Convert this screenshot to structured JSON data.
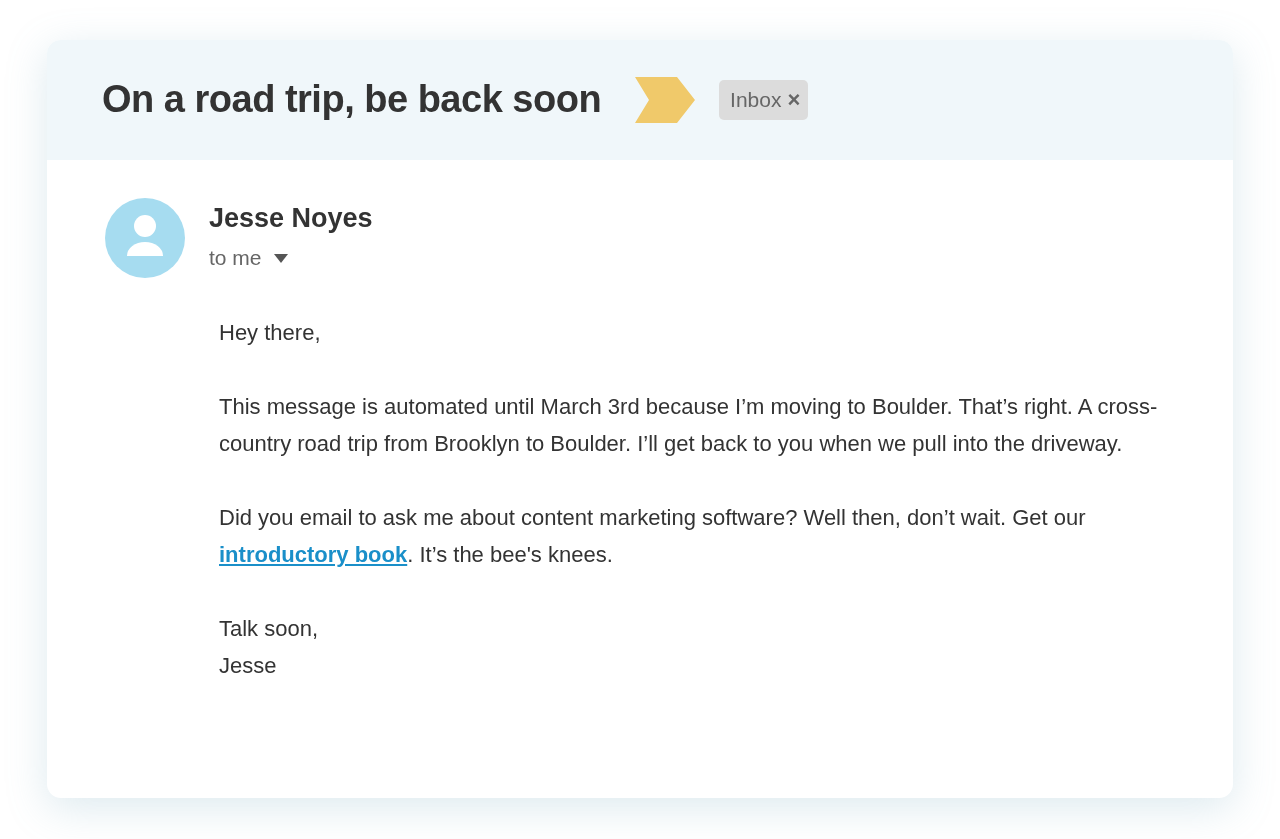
{
  "email": {
    "subject": "On a road trip, be back soon",
    "label": {
      "text": "Inbox",
      "close": "×"
    },
    "sender": {
      "name": "Jesse Noyes",
      "recipient": "to me"
    },
    "body": [
      {
        "segments": [
          {
            "kind": "text",
            "text": "Hey there,"
          }
        ]
      },
      {
        "segments": [
          {
            "kind": "text",
            "text": "This message is automated until March 3rd because I’m moving to Boulder. That’s right. A cross-country road trip from Brooklyn to Boulder. I’ll get back to you when we pull into the driveway."
          }
        ]
      },
      {
        "segments": [
          {
            "kind": "text",
            "text": "Did you email to ask me about content marketing software? Well then, don’t wait. Get our "
          },
          {
            "kind": "link",
            "text": "introductory book"
          },
          {
            "kind": "text",
            "text": ". It’s the bee's knees."
          }
        ]
      },
      {
        "segments": [
          {
            "kind": "text",
            "text": "Talk soon,"
          }
        ]
      },
      {
        "segments": [
          {
            "kind": "text",
            "text": "Jesse"
          }
        ]
      }
    ]
  }
}
